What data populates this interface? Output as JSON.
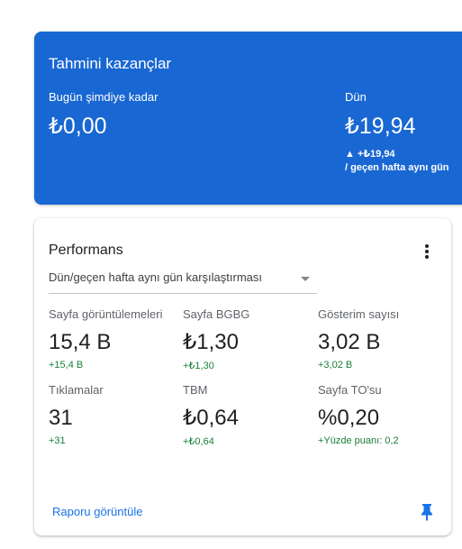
{
  "earnings": {
    "title": "Tahmini kazançlar",
    "today_label": "Bugün şimdiye kadar",
    "today_value": "₺0,00",
    "yesterday_label": "Dün",
    "yesterday_value": "₺19,94",
    "yesterday_change": "▲ +₺19,94",
    "yesterday_compare": "/ geçen hafta aynı gün",
    "bg_color": "#1967d2"
  },
  "performance": {
    "title": "Performans",
    "compare_selected": "Dün/geçen hafta aynı gün karşılaştırması",
    "metrics": [
      {
        "label": "Sayfa görüntülemeleri",
        "value": "15,4 B",
        "change": "+15,4 B"
      },
      {
        "label": "Sayfa BGBG",
        "value": "₺1,30",
        "change": "+₺1,30"
      },
      {
        "label": "Gösterim sayısı",
        "value": "3,02 B",
        "change": "+3,02 B"
      },
      {
        "label": "Tıklamalar",
        "value": "31",
        "change": "+31"
      },
      {
        "label": "TBM",
        "value": "₺0,64",
        "change": "+₺0,64"
      },
      {
        "label": "Sayfa TO'su",
        "value": "%0,20",
        "change": "+Yüzde puanı: 0,2"
      }
    ],
    "view_report_label": "Raporu görüntüle",
    "positive_color": "#188038",
    "link_color": "#1a73e8"
  },
  "icons": {
    "more": "more-vert-icon",
    "dropdown": "caret-down-icon",
    "pin": "pin-icon"
  }
}
